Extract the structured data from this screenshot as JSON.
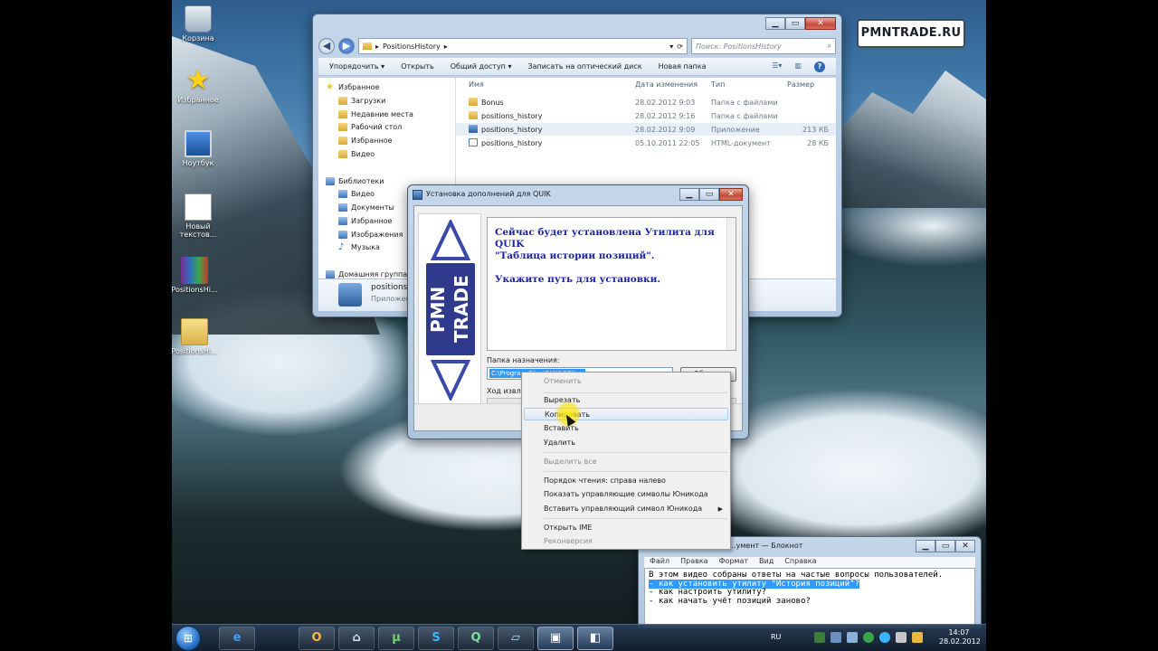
{
  "desktop": {
    "icons": [
      {
        "label": "Корзина",
        "icon": "recycle-bin-icon"
      },
      {
        "label": "Избранное",
        "icon": "star-icon"
      },
      {
        "label": "Ноутбук",
        "icon": "computer-icon"
      },
      {
        "label": "Новый текстов...",
        "icon": "text-document-icon"
      },
      {
        "label": "PositionsHi...",
        "icon": "archive-icon"
      },
      {
        "label": "PositionsHi...",
        "icon": "folder-icon"
      }
    ]
  },
  "watermark": "PMNTRADE.RU",
  "explorer": {
    "address": "PositionsHistory",
    "search_placeholder": "Поиск: PositionsHistory",
    "toolbar": [
      "Упорядочить ▾",
      "Открыть",
      "Общий доступ ▾",
      "Записать на оптический диск",
      "Новая папка"
    ],
    "nav": {
      "favorites": "Избранное",
      "favorites_items": [
        "Загрузки",
        "Недавние места",
        "Рабочий стол",
        "Избранное",
        "Видео"
      ],
      "libraries": "Библиотеки",
      "libraries_items": [
        "Видео",
        "Документы",
        "Избранное",
        "Изображения",
        "Музыка"
      ],
      "homegroup": "Домашняя группа"
    },
    "columns": {
      "name": "Имя",
      "date": "Дата изменения",
      "type": "Тип",
      "size": "Размер"
    },
    "files": [
      {
        "name": "Bonus",
        "date": "28.02.2012 9:03",
        "type": "Папка с файлами",
        "size": "",
        "kind": "folder"
      },
      {
        "name": "positions_history",
        "date": "28.02.2012 9:16",
        "type": "Папка с файлами",
        "size": "",
        "kind": "folder"
      },
      {
        "name": "positions_history",
        "date": "28.02.2012 9:09",
        "type": "Приложение",
        "size": "213 КБ",
        "kind": "app"
      },
      {
        "name": "positions_history",
        "date": "05.10.2011 22:05",
        "type": "HTML-документ",
        "size": "28 КБ",
        "kind": "html"
      }
    ],
    "details": {
      "name": "positions_hi...",
      "type": "Приложени..."
    }
  },
  "installer": {
    "title": "Установка дополнений для QUIK",
    "logo_text": "PMN TRADE",
    "message_line1": "Сейчас будет установлена Утилита для QUIK",
    "message_line2": "\"Таблица истории позиций\".",
    "message_line3": "Укажите путь для установки.",
    "dest_label": "Папка назначения:",
    "dest_value": "C:\\Program Files\\QUIK\\QBIL...",
    "browse_label": "Обзор...",
    "progress_label": "Ход извлеч..."
  },
  "context_menu": {
    "items": [
      {
        "label": "Отменить",
        "disabled": true
      },
      {
        "label": "Вырезать"
      },
      {
        "label": "Копировать",
        "highlighted": true
      },
      {
        "label": "Вставить"
      },
      {
        "label": "Удалить"
      },
      {
        "label": "Выделить все",
        "disabled": true
      },
      {
        "label": "Порядок чтения: справа налево"
      },
      {
        "label": "Показать управляющие символы Юникода"
      },
      {
        "label": "Вставить управляющий символ Юникода",
        "submenu": true
      },
      {
        "label": "Открыть IME"
      },
      {
        "label": "Реконверсия",
        "disabled": true
      }
    ]
  },
  "notepad": {
    "title": "...умент — Блокнот",
    "menu": [
      "Файл",
      "Правка",
      "Формат",
      "Вид",
      "Справка"
    ],
    "lines": [
      "В этом видео собраны ответы на частые вопросы пользователей.",
      "- как установить утилиту \"История позиций\"?",
      "- как настроить утилиту?",
      "- как начать учёт позиций заново?"
    ]
  },
  "taskbar": {
    "apps": [
      {
        "name": "internet-explorer",
        "glyph": "e"
      },
      {
        "name": "outlook",
        "glyph": "O"
      },
      {
        "name": "network",
        "glyph": "⌂"
      },
      {
        "name": "utorrent",
        "glyph": "µ"
      },
      {
        "name": "skype",
        "glyph": "S"
      },
      {
        "name": "quik",
        "glyph": "Q"
      },
      {
        "name": "notes",
        "glyph": "▱"
      },
      {
        "name": "installer",
        "glyph": "▣"
      },
      {
        "name": "setup",
        "glyph": "◧"
      }
    ],
    "lang": "RU",
    "time": "14:07",
    "date": "28.02.2012"
  },
  "colors": {
    "accent": "#3399ff",
    "message_text": "#1b22a6",
    "logo_blue": "#2f3a8c"
  }
}
